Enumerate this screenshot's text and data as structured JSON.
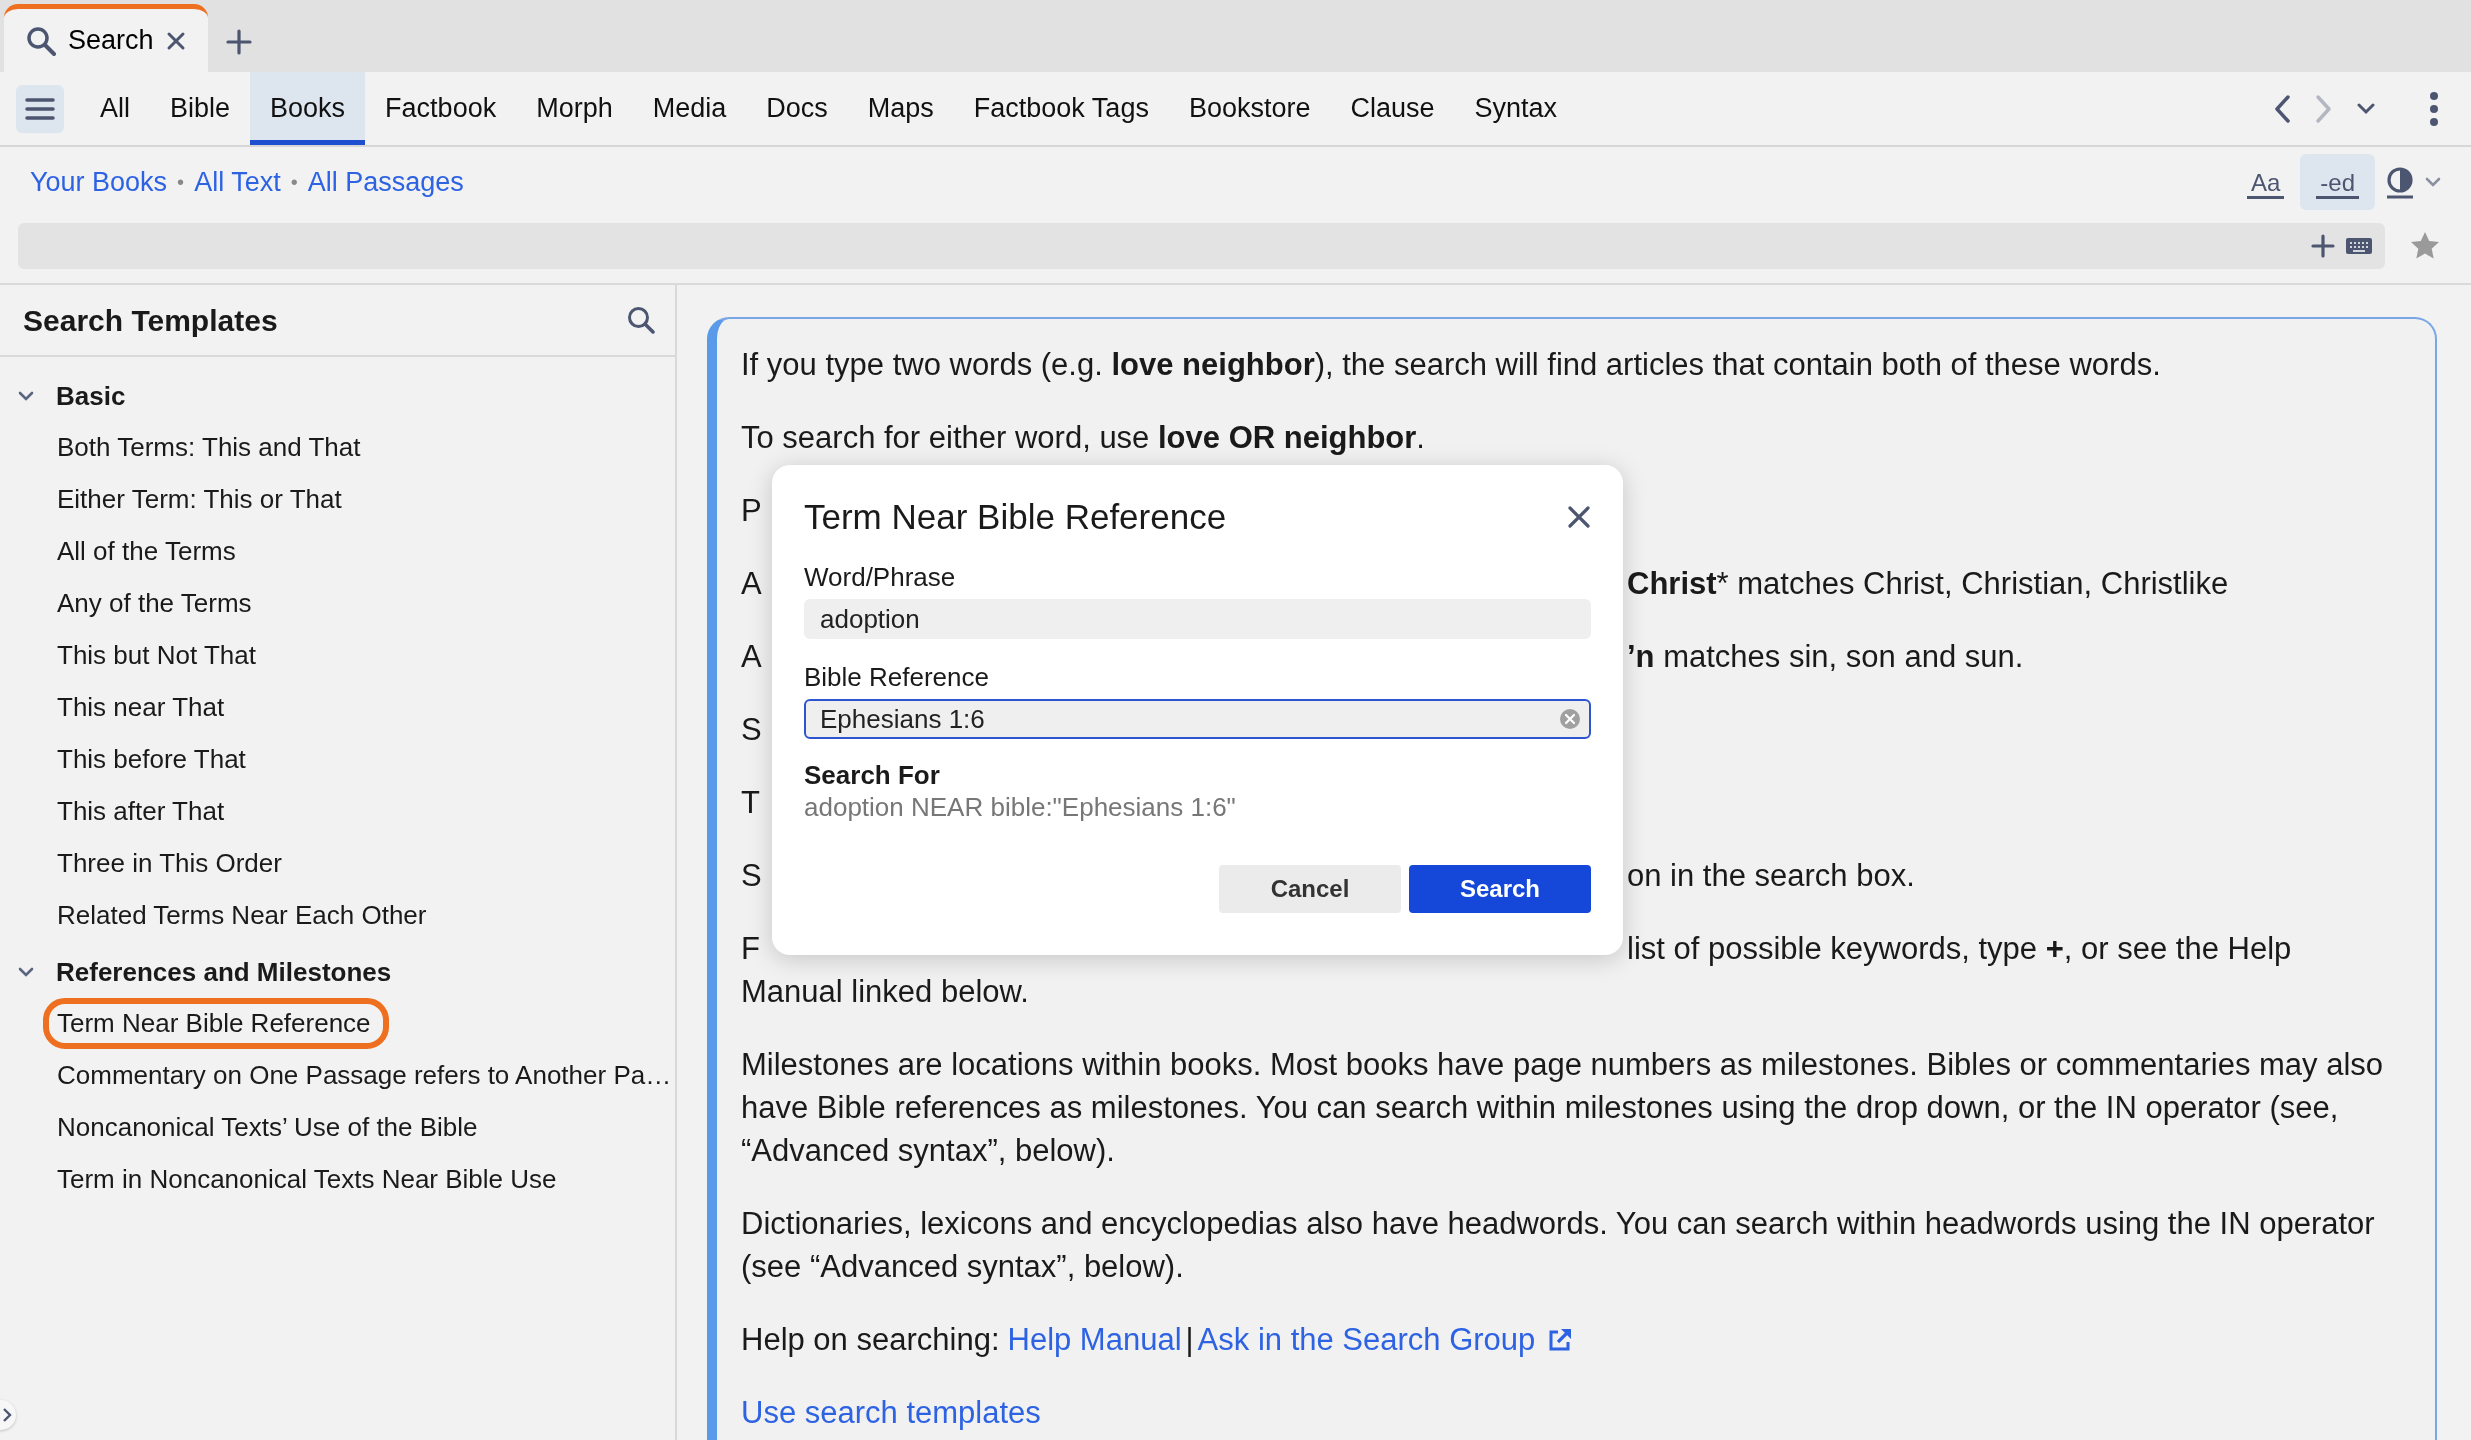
{
  "window_tabs": [
    {
      "label": "Search",
      "selected": true
    }
  ],
  "nav": {
    "tabs": [
      {
        "label": "All",
        "selected": false
      },
      {
        "label": "Bible",
        "selected": false
      },
      {
        "label": "Books",
        "selected": true
      },
      {
        "label": "Factbook",
        "selected": false
      },
      {
        "label": "Morph",
        "selected": false
      },
      {
        "label": "Media",
        "selected": false
      },
      {
        "label": "Docs",
        "selected": false
      },
      {
        "label": "Maps",
        "selected": false
      },
      {
        "label": "Factbook Tags",
        "selected": false
      },
      {
        "label": "Bookstore",
        "selected": false
      },
      {
        "label": "Clause",
        "selected": false
      },
      {
        "label": "Syntax",
        "selected": false
      }
    ],
    "forward_disabled": true
  },
  "scope": {
    "links": [
      "Your Books",
      "All Text",
      "All Passages"
    ],
    "separators": [
      "•",
      "•"
    ]
  },
  "view_options": [
    {
      "label": "Aa",
      "selected": false
    },
    {
      "label": "-ed",
      "selected": true
    }
  ],
  "sidebar": {
    "title": "Search Templates",
    "groups": [
      {
        "label": "Basic",
        "expanded": true,
        "children": [
          {
            "label": "Both Terms: This and That",
            "highlighted": false
          },
          {
            "label": "Either Term: This or That",
            "highlighted": false
          },
          {
            "label": "All of the Terms",
            "highlighted": false
          },
          {
            "label": "Any of the Terms",
            "highlighted": false
          },
          {
            "label": "This but Not That",
            "highlighted": false
          },
          {
            "label": "This near That",
            "highlighted": false
          },
          {
            "label": "This before That",
            "highlighted": false
          },
          {
            "label": "This after That",
            "highlighted": false
          },
          {
            "label": "Three in This Order",
            "highlighted": false
          },
          {
            "label": "Related Terms Near Each Other",
            "highlighted": false
          }
        ]
      },
      {
        "label": "References and Milestones",
        "expanded": true,
        "children": [
          {
            "label": "Term Near Bible Reference",
            "highlighted": true
          },
          {
            "label": "Commentary on One Passage refers to Another Pa…",
            "highlighted": false
          },
          {
            "label": "Noncanonical Texts’ Use of the Bible",
            "highlighted": false
          },
          {
            "label": "Term in Noncanonical Texts Near Bible Use",
            "highlighted": false
          }
        ]
      }
    ]
  },
  "help": {
    "paragraphs": [
      {
        "kind": "full",
        "lines": [
          "If you type two words (e.g. **love neighbor**), the search will find articles that contain both of these words."
        ]
      },
      {
        "kind": "full",
        "lines": [
          "To search for either word, use **love OR neighbor**."
        ]
      },
      {
        "kind": "covered",
        "lines": [
          {
            "left": "P"
          }
        ]
      },
      {
        "kind": "covered",
        "lines": [
          {
            "left": "A",
            "right": "**Christ*** matches Christ, Christian, Christlike"
          }
        ]
      },
      {
        "kind": "covered",
        "lines": [
          {
            "left": "A",
            "right": "**’n** matches sin, son and sun."
          }
        ]
      },
      {
        "kind": "covered",
        "lines": [
          {
            "left": "S"
          }
        ]
      },
      {
        "kind": "covered",
        "lines": [
          {
            "left": "T"
          }
        ]
      },
      {
        "kind": "covered",
        "lines": [
          {
            "left": "S",
            "right": "on in the search box."
          }
        ]
      },
      {
        "kind": "covered",
        "lines": [
          {
            "left": "F",
            "right": "list of possible keywords, type **+**, or see the Help"
          },
          {
            "left": "Manual linked below."
          }
        ]
      },
      {
        "kind": "full",
        "lines": [
          "Milestones are locations within books. Most books have page numbers as milestones. Bibles or commentaries may also have Bible references as milestones. You can search within milestones using the drop down, or the IN operator (see, “Advanced syntax”, below)."
        ]
      },
      {
        "kind": "full",
        "lines": [
          "Dictionaries, lexicons and encyclopedias also have headwords. You can search within headwords using the IN operator (see “Advanced syntax”, below)."
        ]
      }
    ],
    "help_label": "Help on searching:",
    "help_links": [
      "Help Manual",
      "Ask in the Search Group"
    ],
    "link_separator": "|",
    "templates_link": "Use search templates"
  },
  "dialog": {
    "title": "Term Near Bible Reference",
    "fields": [
      {
        "label": "Word/Phrase",
        "value": "adoption",
        "focused": false
      },
      {
        "label": "Bible Reference",
        "value": "Ephesians 1:6",
        "focused": true
      }
    ],
    "search_for_label": "Search For",
    "search_for_value": "adoption NEAR bible:\"Ephesians 1:6\"",
    "buttons": [
      {
        "label": "Cancel",
        "kind": "secondary"
      },
      {
        "label": "Search",
        "kind": "primary"
      }
    ]
  }
}
